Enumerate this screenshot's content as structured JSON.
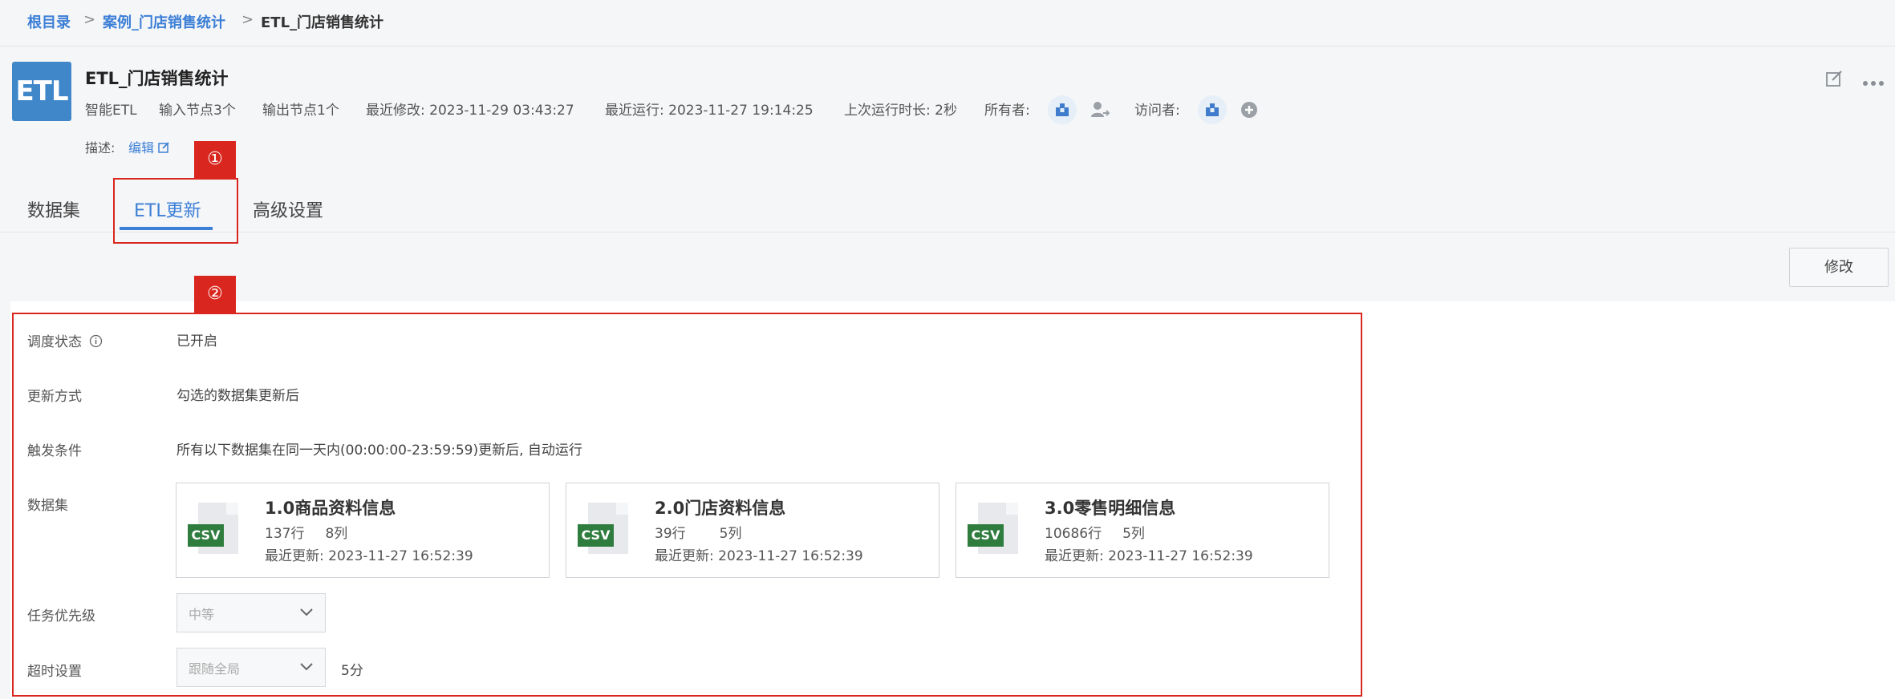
{
  "breadcrumb": {
    "root": "根目录",
    "sep1": ">",
    "folder": "案例_门店销售统计",
    "sep2": ">",
    "current": "ETL_门店销售统计"
  },
  "header": {
    "logo_text": "ETL",
    "title": "ETL_门店销售统计",
    "type": "智能ETL",
    "input_nodes": "输入节点3个",
    "output_nodes": "输出节点1个",
    "last_modified": "最近修改: 2023-11-29 03:43:27",
    "last_run": "最近运行: 2023-11-27 19:14:25",
    "last_duration": "上次运行时长: 2秒",
    "owner_label": "所有者:",
    "visitor_label": "访问者:",
    "desc_label": "描述:",
    "desc_edit": "编辑"
  },
  "annotations": {
    "badge1": "①",
    "badge2": "②"
  },
  "tabs": [
    "数据集",
    "ETL更新",
    "高级设置"
  ],
  "active_tab": "ETL更新",
  "modify_button": "修改",
  "settings": {
    "schedule_label": "调度状态",
    "schedule_value": "已开启",
    "update_mode_label": "更新方式",
    "update_mode_value": "勾选的数据集更新后",
    "trigger_label": "触发条件",
    "trigger_value": "所有以下数据集在同一天内(00:00:00-23:59:59)更新后, 自动运行",
    "datasets_label": "数据集",
    "priority_label": "任务优先级",
    "priority_value": "中等",
    "timeout_label": "超时设置",
    "timeout_value": "跟随全局",
    "timeout_extra": "5分"
  },
  "datasets": [
    {
      "icon": "CSV",
      "name": "1.0商品资料信息",
      "rows": "137行",
      "cols": "8列",
      "updated": "最近更新: 2023-11-27 16:52:39"
    },
    {
      "icon": "CSV",
      "name": "2.0门店资料信息",
      "rows": "39行",
      "cols": "5列",
      "updated": "最近更新: 2023-11-27 16:52:39"
    },
    {
      "icon": "CSV",
      "name": "3.0零售明细信息",
      "rows": "10686行",
      "cols": "5列",
      "updated": "最近更新: 2023-11-27 16:52:39"
    }
  ],
  "colors": {
    "accent": "#3c7fd6",
    "annotation": "#d9271f",
    "csv": "#2f7d3e",
    "logo": "#3f87c9"
  }
}
